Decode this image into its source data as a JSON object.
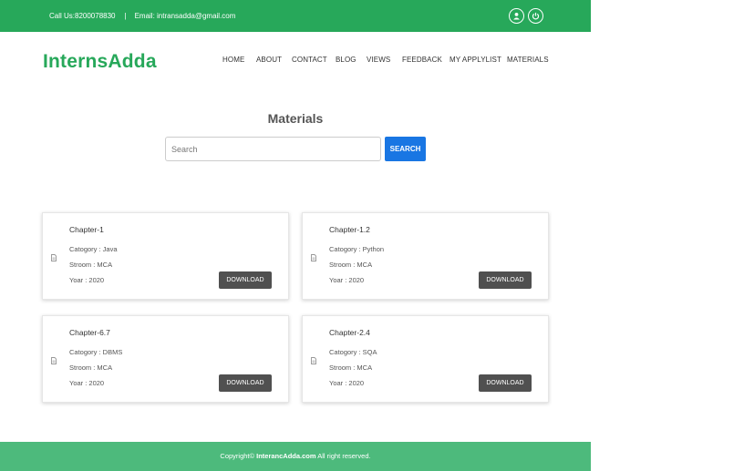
{
  "topbar": {
    "phone": "Call Us:8200078830",
    "separator": "|",
    "email": "Email: intransadda@gmail.com",
    "color": "#27a85a"
  },
  "header": {
    "logo": "InternsAdda",
    "nav": [
      "HOME",
      "ABOUT",
      "CONTACT",
      "BLOG",
      "VIEWS",
      "FEEDBACK",
      "MY APPLYLIST",
      "MATERIALS"
    ]
  },
  "main": {
    "title": "Materials",
    "search": {
      "placeholder": "Search",
      "button_label": "SEARCH"
    },
    "cards": [
      {
        "title": "Chapter-1",
        "category": "Catogory : Java",
        "stream": "Stroom : MCA",
        "year": "Yoar : 2020",
        "button": "DOWNLOAD"
      },
      {
        "title": "Chapter-1.2",
        "category": "Catogory : Python",
        "stream": "Stroom : MCA",
        "year": "Yoar : 2020",
        "button": "DOWNLOAD"
      },
      {
        "title": "Chapter-6.7",
        "category": "Catogory : DBMS",
        "stream": "Stroom : MCA",
        "year": "Yoar : 2020",
        "button": "DOWNLOAD"
      },
      {
        "title": "Chapter-2.4",
        "category": "Catogory : SQA",
        "stream": "Stroom : MCA",
        "year": "Yoar : 2020",
        "button": "DOWNLOAD"
      }
    ]
  },
  "footer": {
    "prefix": "Copyright©",
    "brand": "InterancAdda.com",
    "suffix": "All right reserved.",
    "color": "#4dba7c"
  }
}
